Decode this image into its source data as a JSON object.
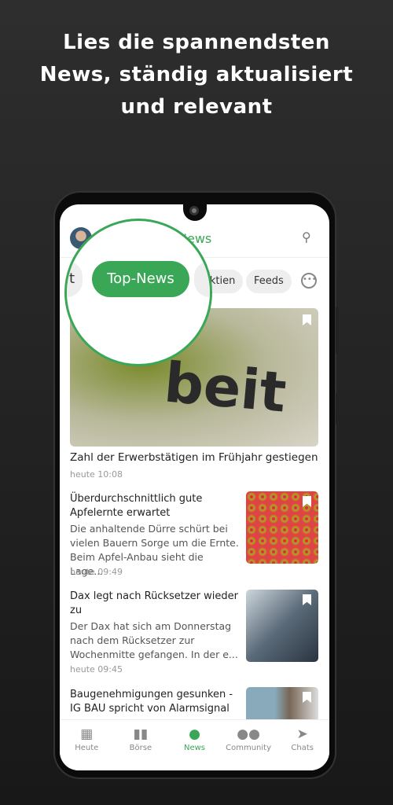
{
  "headline": [
    "Lies die spannendsten",
    "News, ständig aktualisiert",
    "und relevant"
  ],
  "header": {
    "title": "News"
  },
  "tabs": [
    {
      "label": "t"
    },
    {
      "label": "Top-News",
      "active": true
    },
    {
      "label": "Aktien"
    },
    {
      "label": "Feeds"
    }
  ],
  "articles": [
    {
      "title": "Zahl der Erwerbstätigen im Frühjahr gestiegen",
      "time": "heute 10:08",
      "image_text": "beit"
    },
    {
      "title": "Überdurchschnittlich gute Apfelernte erwartet",
      "desc": "Die anhaltende Dürre schürt bei vielen Bauern Sorge um die Ernte. Beim Apfel-Anbau sieht die Lage...",
      "time": "heute 09:49"
    },
    {
      "title": "Dax legt nach Rücksetzer wieder zu",
      "desc": "Der Dax hat sich am Donnerstag nach dem Rücksetzer zur Wochenmitte gefangen. In der e...",
      "time": "heute 09:45"
    },
    {
      "title": "Baugenehmigungen gesunken - IG BAU spricht von Alarmsignal"
    }
  ],
  "nav": [
    {
      "label": "Heute",
      "icon": "calendar-clock-icon"
    },
    {
      "label": "Börse",
      "icon": "bar-chart-icon"
    },
    {
      "label": "News",
      "icon": "globe-icon",
      "active": true
    },
    {
      "label": "Community",
      "icon": "people-icon"
    },
    {
      "label": "Chats",
      "icon": "send-icon"
    }
  ],
  "colors": {
    "accent": "#3aa757"
  }
}
